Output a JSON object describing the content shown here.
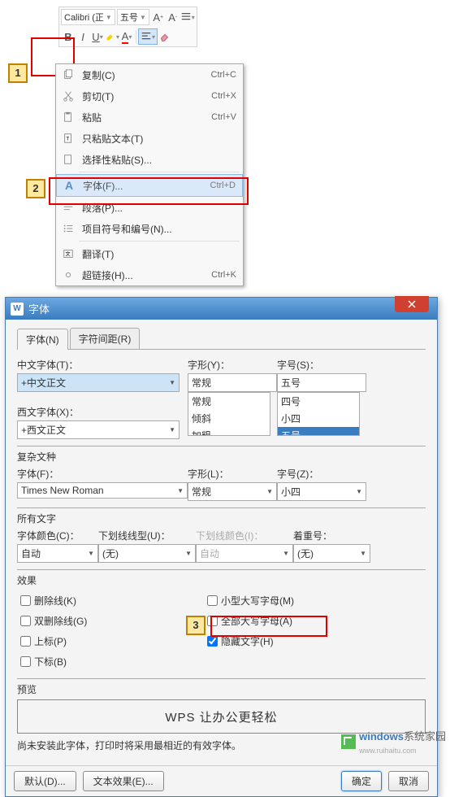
{
  "tb": {
    "font": "Calibri (正",
    "size": "五号"
  },
  "menu": {
    "copy": {
      "l": "复制(C)",
      "s": "Ctrl+C"
    },
    "cut": {
      "l": "剪切(T)",
      "s": "Ctrl+X"
    },
    "paste": {
      "l": "粘贴",
      "s": "Ctrl+V"
    },
    "pastetxt": {
      "l": "只粘贴文本(T)"
    },
    "pastesp": {
      "l": "选择性粘贴(S)..."
    },
    "font": {
      "l": "字体(F)...",
      "s": "Ctrl+D"
    },
    "para": {
      "l": "段落(P)..."
    },
    "bullet": {
      "l": "项目符号和编号(N)..."
    },
    "trans": {
      "l": "翻译(T)"
    },
    "link": {
      "l": "超链接(H)...",
      "s": "Ctrl+K"
    }
  },
  "dlg": {
    "title": "字体",
    "tab1": "字体(N)",
    "tab2": "字符间距(R)",
    "cfont": "中文字体(T)：",
    "cfontv": "+中文正文",
    "wfont": "西文字体(X)：",
    "wfontv": "+西文正文",
    "style": "字形(Y)：",
    "stylev": "常规",
    "styles": [
      "常规",
      "倾斜",
      "加粗"
    ],
    "size": "字号(S)：",
    "sizev": "五号",
    "sizes": [
      "四号",
      "小四",
      "五号"
    ],
    "complex": "复杂文种",
    "cfont2": "字体(F)：",
    "cfont2v": "Times New Roman",
    "style2": "字形(L)：",
    "style2v": "常规",
    "size2": "字号(Z)：",
    "size2v": "小四",
    "alltext": "所有文字",
    "color": "字体颜色(C)：",
    "colorv": "自动",
    "ul": "下划线线型(U)：",
    "ulv": "(无)",
    "ulc": "下划线颜色(I)：",
    "ulcv": "自动",
    "emph": "着重号：",
    "emphv": "(无)",
    "fx": "效果",
    "strike": "删除线(K)",
    "dstrike": "双删除线(G)",
    "sup": "上标(P)",
    "sub": "下标(B)",
    "scaps": "小型大写字母(M)",
    "caps": "全部大写字母(A)",
    "hidden": "隐藏文字(H)",
    "prev": "预览",
    "prevt": "WPS 让办公更轻松",
    "note": "尚未安装此字体，打印时将采用最相近的有效字体。",
    "def": "默认(D)...",
    "tfx": "文本效果(E)...",
    "ok": "确定",
    "cancel": "取消"
  },
  "num": {
    "n1": "1",
    "n2": "2",
    "n3": "3"
  },
  "wm": {
    "t1": "windows",
    "t2": "系统家园",
    "url": "www.ruihaitu.com"
  }
}
